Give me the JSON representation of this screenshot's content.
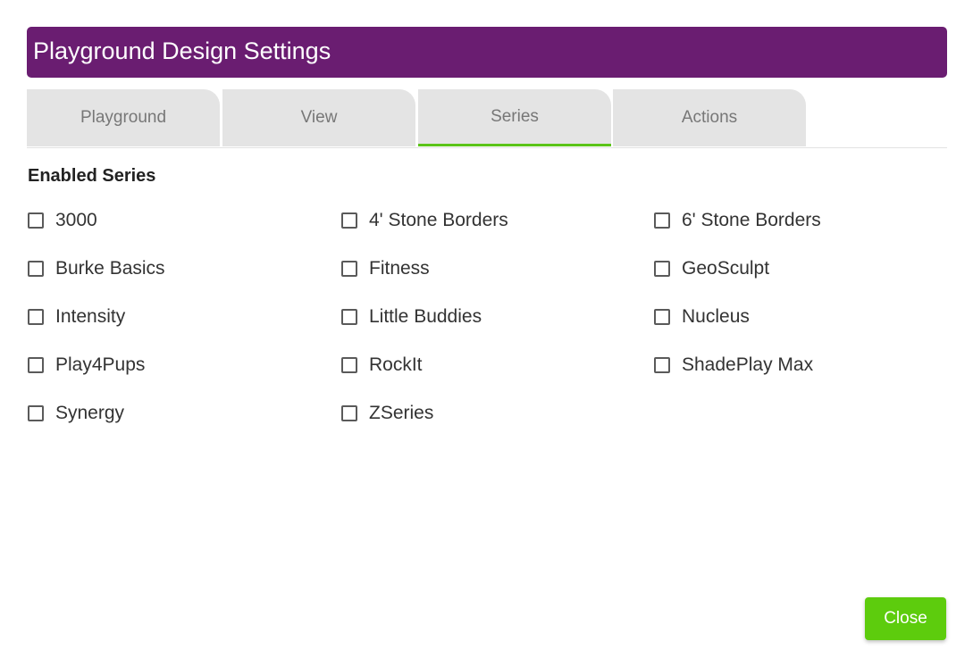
{
  "dialog": {
    "title": "Playground Design Settings"
  },
  "tabs": [
    {
      "label": "Playground",
      "active": false
    },
    {
      "label": "View",
      "active": false
    },
    {
      "label": "Series",
      "active": true
    },
    {
      "label": "Actions",
      "active": false
    }
  ],
  "series_section": {
    "heading": "Enabled Series",
    "items": [
      {
        "label": "3000",
        "checked": false
      },
      {
        "label": "4' Stone Borders",
        "checked": false
      },
      {
        "label": "6' Stone Borders",
        "checked": false
      },
      {
        "label": "Burke Basics",
        "checked": false
      },
      {
        "label": "Fitness",
        "checked": false
      },
      {
        "label": "GeoSculpt",
        "checked": false
      },
      {
        "label": "Intensity",
        "checked": false
      },
      {
        "label": "Little Buddies",
        "checked": false
      },
      {
        "label": "Nucleus",
        "checked": false
      },
      {
        "label": "Play4Pups",
        "checked": false
      },
      {
        "label": "RockIt",
        "checked": false
      },
      {
        "label": "ShadePlay Max",
        "checked": false
      },
      {
        "label": "Synergy",
        "checked": false
      },
      {
        "label": "ZSeries",
        "checked": false
      }
    ]
  },
  "footer": {
    "close_label": "Close"
  },
  "colors": {
    "title_bar": "#6a1d71",
    "active_tab_indicator": "#5bc418",
    "close_button": "#5dcc0d",
    "tab_background": "#e4e4e4"
  }
}
